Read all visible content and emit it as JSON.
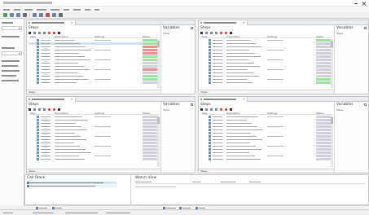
{
  "window": {
    "title": ""
  },
  "menubar": {
    "items": [
      "",
      "",
      "",
      "",
      "",
      "",
      "",
      "",
      ""
    ]
  },
  "panes": [
    {
      "tab": "",
      "steps_label": "Steps",
      "variables_label": "Variables",
      "columns": [
        "Step",
        "Description",
        "Settings",
        "Status"
      ],
      "rows": [
        "pass",
        "pass",
        "fail",
        "fail",
        "fail",
        "pass",
        "pass",
        "done",
        "done",
        "fail",
        "done",
        "pass",
        "pass",
        "done"
      ]
    },
    {
      "tab": "",
      "steps_label": "Steps",
      "variables_label": "Variables",
      "columns": [
        "Step",
        "Description",
        "Settings",
        "Status"
      ],
      "rows": [
        "pass",
        "done",
        "done",
        "done",
        "done",
        "done",
        "done",
        "done",
        "done",
        "done",
        "done",
        "done",
        "pass",
        "pass"
      ]
    },
    {
      "tab": "",
      "steps_label": "Steps",
      "variables_label": "Variables",
      "columns": [
        "Step",
        "Description",
        "Settings",
        "Status"
      ],
      "rows": [
        "done",
        "done",
        "done",
        "done",
        "done",
        "done",
        "done",
        "done",
        "done",
        "done",
        "done",
        "done",
        "done",
        "done"
      ]
    },
    {
      "tab": "",
      "steps_label": "Steps",
      "variables_label": "Variables",
      "columns": [
        "Step",
        "Description",
        "Settings",
        "Status"
      ],
      "rows": [
        "done",
        "done",
        "done",
        "done",
        "done",
        "done",
        "done",
        "done",
        "done",
        "done",
        "done",
        "done",
        "done",
        "done"
      ]
    }
  ],
  "variables": {
    "value_column": "Value"
  },
  "call_stack": {
    "label": "Call Stack",
    "lines": [
      "",
      ""
    ]
  },
  "watch_view": {
    "label": "Watch View",
    "columns": [
      "",
      "",
      "",
      ""
    ],
    "hint": ""
  },
  "status_colors": {
    "pass": "#9be29b",
    "fail": "#f08c8c",
    "done": "#cfcfdd",
    "running": "#ffe37a",
    "selected": "#cfe3f7"
  }
}
